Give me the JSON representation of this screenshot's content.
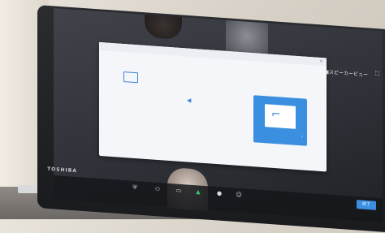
{
  "meeting_view": {
    "top_right_label": "■スピーカービュー",
    "dialog": {
      "title": "",
      "tabs": [
        "",
        ""
      ],
      "footer_left": "",
      "footer_mid": ""
    },
    "end_button": "終了",
    "brand": "TOSHIBA",
    "colors": {
      "accent": "#3b8fe0",
      "screen": "#26292e"
    }
  }
}
